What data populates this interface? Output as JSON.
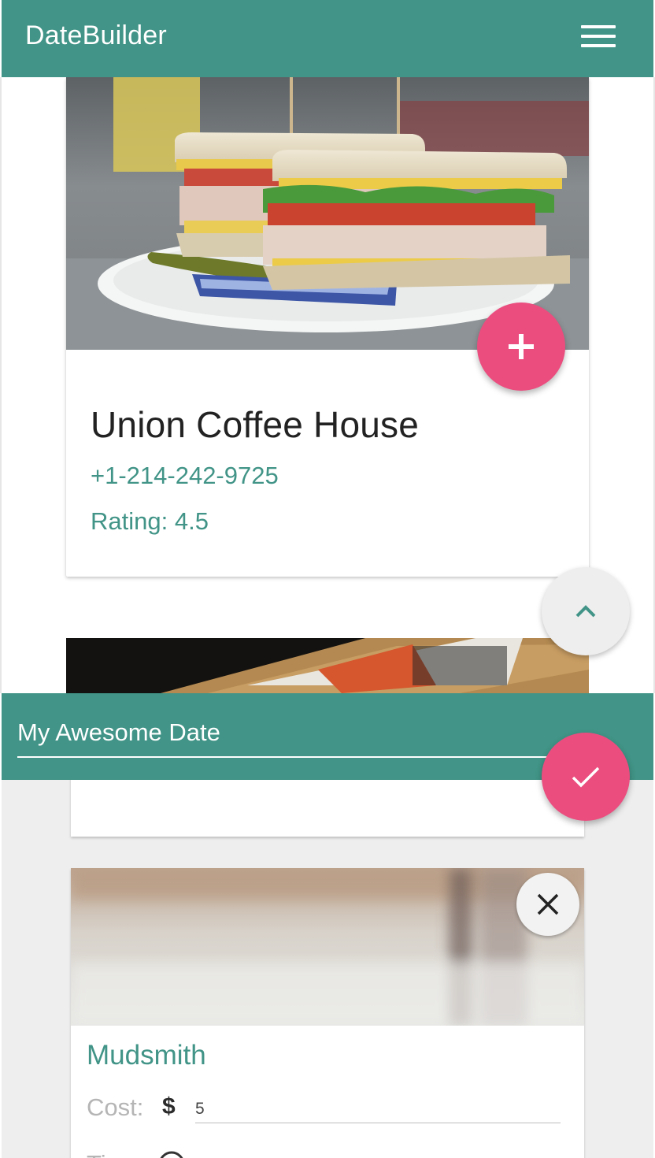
{
  "app": {
    "title": "DateBuilder",
    "accent_color": "#419487",
    "fab_color": "#eb4d7f"
  },
  "header": {
    "menu_icon": "hamburger-menu-icon"
  },
  "place_card": {
    "name": "Union Coffee House",
    "phone": "+1-214-242-9725",
    "rating": "Rating: 4.5",
    "add_icon": "plus-icon"
  },
  "scroll_up_icon": "chevron-up-icon",
  "date_panel": {
    "title_value": "My Awesome Date",
    "confirm_icon": "check-icon",
    "stop": {
      "name": "Mudsmith",
      "cost_label": "Cost:",
      "cost_symbol": "$",
      "cost_value": "5",
      "time_label": "Time:",
      "remove_icon": "close-icon",
      "clock_icon": "clock-icon"
    }
  }
}
